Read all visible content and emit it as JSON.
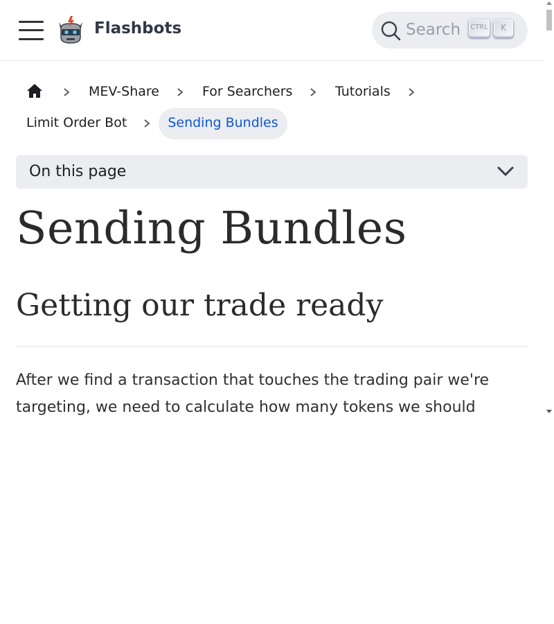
{
  "navbar": {
    "brand": "Flashbots",
    "search": {
      "placeholder": "Search",
      "shortcut_ctrl": "CTRL",
      "shortcut_key": "K"
    }
  },
  "breadcrumbs": {
    "items": [
      "MEV-Share",
      "For Searchers",
      "Tutorials",
      "Limit Order Bot"
    ],
    "active": "Sending Bundles"
  },
  "toc": {
    "label": "On this page"
  },
  "content": {
    "title": "Sending Bundles",
    "section_heading": "Getting our trade ready",
    "paragraph": "After we find a transaction that touches the trading pair we're targeting, we need to calculate how many tokens we should"
  },
  "colors": {
    "accent": "#0f56d6",
    "chip_bg": "#ebedf0"
  },
  "icons": [
    "hamburger-menu-icon",
    "flashbots-robot-logo",
    "search-icon",
    "home-icon",
    "chevron-right-icon",
    "chevron-down-icon"
  ]
}
